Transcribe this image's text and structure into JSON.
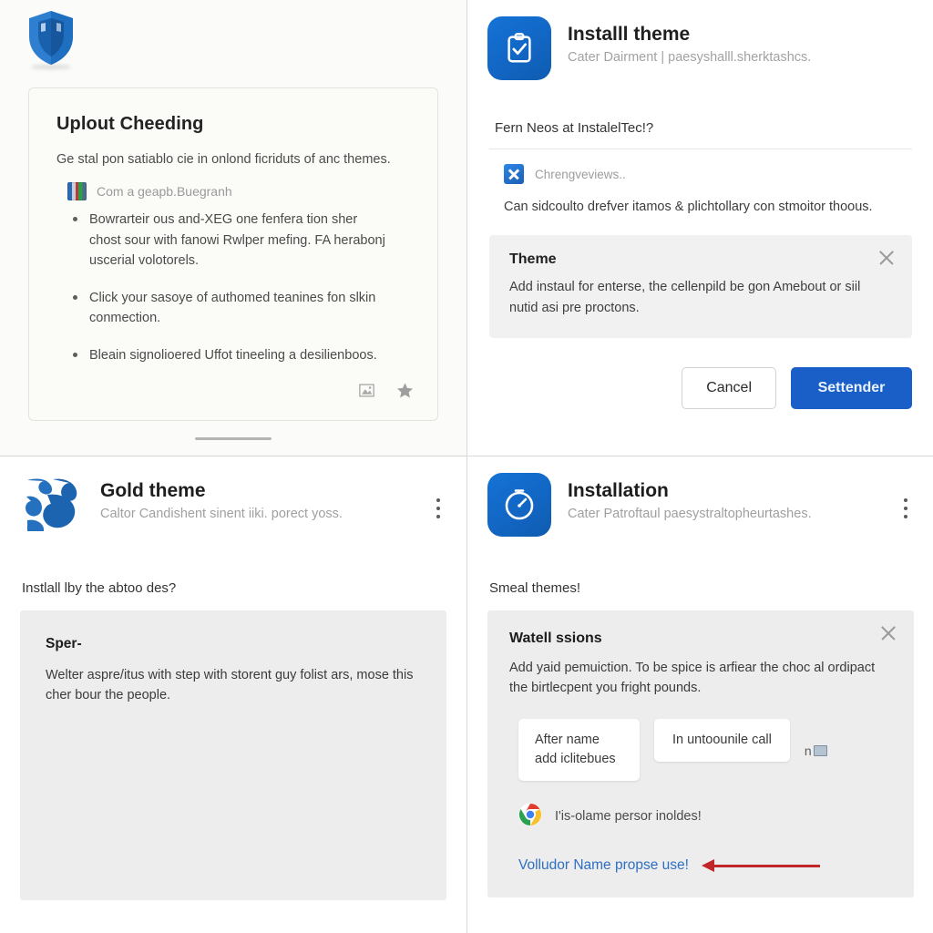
{
  "panel_top_left": {
    "shield_icon": "shield-icon",
    "card": {
      "title": "Uplout Cheeding",
      "lead": "Ge stal pon satiablo cie in onlond ficriduts of anc themes.",
      "chip_label": "Com a geapb.Buegranh",
      "bullets": [
        "Bowrarteir ous and-XEG one fenfera tion sher chost sour with fanowi Rwlper mefing. FA herabonj uscerial volotorels.",
        "Click your sasoye of authomed teanines fon slkin conmection.",
        "Bleain signolioered Uffot tineeling a desilienboos."
      ],
      "footer_icons": [
        "image-icon",
        "star-icon"
      ]
    },
    "scroll_indicator": "scroll-handle"
  },
  "panel_top_right": {
    "app_icon": "clipboard-check-icon",
    "title": "Installl theme",
    "subtitle": "Cater Dairment | paesyshalll.sherktashcs.",
    "question": "Fern Neos at InstalelTec!?",
    "source_icon": "x-app-icon",
    "source_label": "Chrengveviews..",
    "body": "Can sidcoulto drefver itamos & plichtollary con stmoitor thoous.",
    "inner_box": {
      "heading": "Theme",
      "text": "Add instaul for enterse, the cellenpild be gon Amebout or siil nutid asi pre proctons.",
      "close_icon": "close-icon"
    },
    "buttons": {
      "cancel": "Cancel",
      "primary": "Settender"
    }
  },
  "panel_bottom_left": {
    "logo_icon": "gold-theme-logo-icon",
    "title": "Gold theme",
    "subtitle": "Caltor Candishent sinent iiki. porect yoss.",
    "menu_icon": "kebab-menu-icon",
    "question": "Instlall lby the abtoo des?",
    "box": {
      "heading": "Sper-",
      "text": "Welter aspre/itus with step with storent guy folist ars, mose this cher bour the people."
    }
  },
  "panel_bottom_right": {
    "app_icon": "stopwatch-icon",
    "title": "Installation",
    "subtitle": "Cater Patroftaul paesystraltopheurtashes.",
    "menu_icon": "kebab-menu-icon",
    "question": "Smeal themes!",
    "box": {
      "heading": "Watell ssions",
      "text": "Add yaid pemuiction. To be spice is arfiear the choc al ordipact the birtlecpent you fright pounds.",
      "close_icon": "close-icon",
      "option_one": "After name add iclitebues",
      "option_two": "In untoounile call",
      "badge_text": "n",
      "badge_icon": "card-icon",
      "chrome_icon": "chrome-icon",
      "chrome_text": "I'is-olame persor inoldes!",
      "link": "Volludor Name propse use!",
      "arrow_icon": "left-arrow-annotation"
    }
  },
  "colors": {
    "primary_blue": "#1a5fc8",
    "link_blue": "#2e6fc4",
    "annotation_red": "#c0262a",
    "panel_bg": "#ffffff",
    "card_bg": "#fbfbf8",
    "grey_box": "#ededed"
  }
}
